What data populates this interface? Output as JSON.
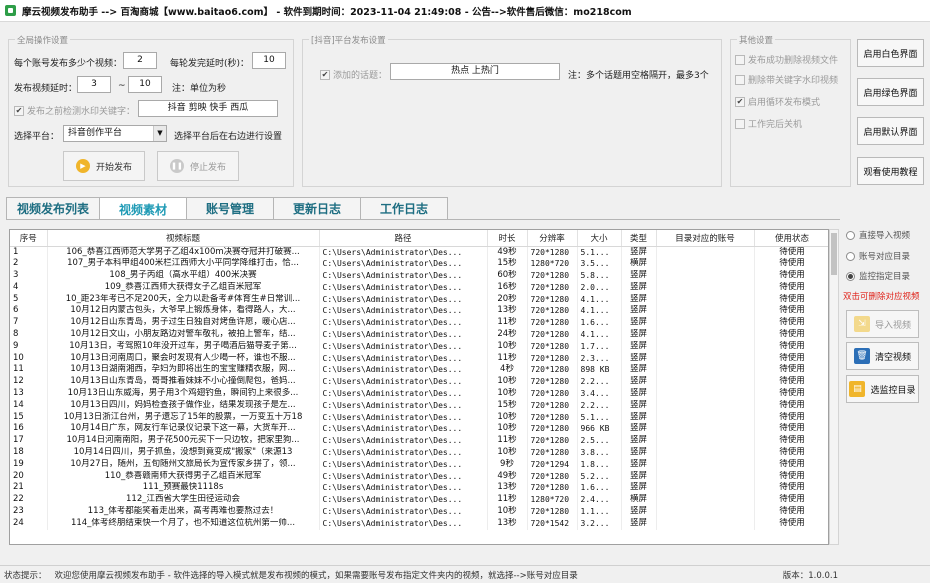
{
  "titlebar": {
    "title": "摩云视频发布助手  --> 百淘商城【www.baitao6.com】 - 软件到期时间：2023-11-04 21:49:08 - 公告-->软件售后微信：mo218com"
  },
  "global_ops": {
    "legend": "全局操作设置",
    "per_account_label": "每个账号发布多少个视频：",
    "per_account_value": "2",
    "global_delay_label": "每轮发完延时(秒)：",
    "global_delay_value": "10",
    "video_delay_label": "发布视频延时：",
    "video_delay_min": "3",
    "tilde": "~",
    "video_delay_max": "10",
    "video_delay_note": "注：单位为秒",
    "detect_watermark_label": "发布之前检测水印关键字：",
    "detect_watermark_value": "抖音 剪映 快手 西瓜",
    "platform_label": "选择平台：",
    "platform_value": "抖音创作平台",
    "platform_note": "选择平台后在右边进行设置",
    "start_label": "开始发布",
    "stop_label": "停止发布"
  },
  "douyin": {
    "legend": "[抖音]平台发布设置",
    "topic_label": "添加的话题：",
    "topic_value": "热点 上热门",
    "topic_note": "注：多个话题用空格隔开，最多3个"
  },
  "other": {
    "legend": "其他设置",
    "opt1": "发布成功删除视频文件",
    "opt2": "删除带关键字水印视频",
    "opt3": "启用循环发布模式",
    "opt4": "工作完后关机"
  },
  "right_buttons": {
    "white": "启用白色界面",
    "green": "启用绿色界面",
    "default": "启用默认界面",
    "tutorial": "观看使用教程"
  },
  "tabs": [
    "视频发布列表",
    "视频素材",
    "账号管理",
    "更新日志",
    "工作日志"
  ],
  "table": {
    "headers": [
      "序号",
      "视频标题",
      "路径",
      "时长",
      "分辨率",
      "大小",
      "类型",
      "目录对应的账号",
      "使用状态"
    ],
    "rows": [
      [
        "1",
        "106_恭喜江西师范大学男子乙组4x100m决赛夺冠并打破赛...",
        "C:\\Users\\Administrator\\Des...",
        "49秒",
        "720*1280",
        "5.1...",
        "竖屏",
        "",
        "待使用"
      ],
      [
        "2",
        "107_男子本科甲组400米栏江西师大小平同学降维打击，恰...",
        "C:\\Users\\Administrator\\Des...",
        "15秒",
        "1280*720",
        "3.5...",
        "横屏",
        "",
        "待使用"
      ],
      [
        "3",
        "108_男子丙组（高水平组）400米决赛",
        "C:\\Users\\Administrator\\Des...",
        "60秒",
        "720*1280",
        "5.8...",
        "竖屏",
        "",
        "待使用"
      ],
      [
        "4",
        "109_恭喜江西师大获得女子乙组百米冠军",
        "C:\\Users\\Administrator\\Des...",
        "16秒",
        "720*1280",
        "2.0...",
        "竖屏",
        "",
        "待使用"
      ],
      [
        "5",
        "10_距23年考已不足200天，全力以赴备考#体育生#日常训...",
        "C:\\Users\\Administrator\\Des...",
        "20秒",
        "720*1280",
        "4.1...",
        "竖屏",
        "",
        "待使用"
      ],
      [
        "6",
        "10月12日内蒙古包头，大爷早上锻炼身体，看得路人，大...",
        "C:\\Users\\Administrator\\Des...",
        "13秒",
        "720*1280",
        "4.1...",
        "竖屏",
        "",
        "待使用"
      ],
      [
        "7",
        "10月12日山东青岛，男子过生日独自对烤鱼许愿，暖心店...",
        "C:\\Users\\Administrator\\Des...",
        "11秒",
        "720*1280",
        "1.6...",
        "竖屏",
        "",
        "待使用"
      ],
      [
        "8",
        "10月12日文山，小朋友路边对警车敬礼，被拍上警车，结...",
        "C:\\Users\\Administrator\\Des...",
        "24秒",
        "720*1280",
        "4.1...",
        "竖屏",
        "",
        "待使用"
      ],
      [
        "9",
        "10月13日，考驾照10年没开过车，男子喝酒后猫导麦子第...",
        "C:\\Users\\Administrator\\Des...",
        "10秒",
        "720*1280",
        "1.7...",
        "竖屏",
        "",
        "待使用"
      ],
      [
        "10",
        "10月13日河南周口，聚会时发现有人少喝一杯，谁也不服...",
        "C:\\Users\\Administrator\\Des...",
        "11秒",
        "720*1280",
        "2.3...",
        "竖屏",
        "",
        "待使用"
      ],
      [
        "11",
        "10月13日湖南湘西，孕妇为即将出生的宝宝赚精衣服，网...",
        "C:\\Users\\Administrator\\Des...",
        "4秒",
        "720*1280",
        "898 KB",
        "竖屏",
        "",
        "待使用"
      ],
      [
        "12",
        "10月13日山东青岛，哥哥推着妹妹不小心撞倒爬包，爸妈...",
        "C:\\Users\\Administrator\\Des...",
        "10秒",
        "720*1280",
        "2.2...",
        "竖屏",
        "",
        "待使用"
      ],
      [
        "13",
        "10月13日山东威海，男子用3个鸡翅钓鱼，瞬间钓上来很多...",
        "C:\\Users\\Administrator\\Des...",
        "10秒",
        "720*1280",
        "3.4...",
        "竖屏",
        "",
        "待使用"
      ],
      [
        "14",
        "10月13日四川，妈妈检查孩子做作业，结果发现孩子是左...",
        "C:\\Users\\Administrator\\Des...",
        "15秒",
        "720*1280",
        "2.2...",
        "竖屏",
        "",
        "待使用"
      ],
      [
        "15",
        "10月13日浙江台州，男子遗忘了15年的股票，一万变五十万18",
        "C:\\Users\\Administrator\\Des...",
        "10秒",
        "720*1280",
        "5.1...",
        "竖屏",
        "",
        "待使用"
      ],
      [
        "16",
        "10月14日广东，网友行车记录仪记录下这一幕，大货车开...",
        "C:\\Users\\Administrator\\Des...",
        "10秒",
        "720*1280",
        "966 KB",
        "竖屏",
        "",
        "待使用"
      ],
      [
        "17",
        "10月14日河南南阳，男子花500元买下一只边牧，把家里狗...",
        "C:\\Users\\Administrator\\Des...",
        "11秒",
        "720*1280",
        "2.5...",
        "竖屏",
        "",
        "待使用"
      ],
      [
        "18",
        "10月14日四川，男子抓鱼，没想到竟变成\"搬家\"（来源13",
        "C:\\Users\\Administrator\\Des...",
        "10秒",
        "720*1280",
        "3.8...",
        "竖屏",
        "",
        "待使用"
      ],
      [
        "19",
        "10月27日，随州，五旬随州文旅局长为宣传家乡拼了，领...",
        "C:\\Users\\Administrator\\Des...",
        "9秒",
        "720*1294",
        "1.8...",
        "竖屏",
        "",
        "待使用"
      ],
      [
        "20",
        "110_恭喜赣南师大获得男子乙组百米冠军",
        "C:\\Users\\Administrator\\Des...",
        "49秒",
        "720*1280",
        "5.2...",
        "竖屏",
        "",
        "待使用"
      ],
      [
        "21",
        "111_预赛最快1118s",
        "C:\\Users\\Administrator\\Des...",
        "13秒",
        "720*1280",
        "1.6...",
        "竖屏",
        "",
        "待使用"
      ],
      [
        "22",
        "112_江西省大学生田径运动会",
        "C:\\Users\\Administrator\\Des...",
        "11秒",
        "1280*720",
        "2.4...",
        "横屏",
        "",
        "待使用"
      ],
      [
        "23",
        "113_体考都能笑着走出来，高考再难也要熬过去！",
        "C:\\Users\\Administrator\\Des...",
        "10秒",
        "720*1280",
        "1.1...",
        "竖屏",
        "",
        "待使用"
      ],
      [
        "24",
        "114_体考终朋结束快一个月了，也不知道这位杭州第一帅...",
        "C:\\Users\\Administrator\\Des...",
        "13秒",
        "720*1542",
        "3.2...",
        "竖屏",
        "",
        "待使用"
      ]
    ]
  },
  "side": {
    "radio_direct": "直接导入视频",
    "radio_account_dir": "账号对应目录",
    "radio_monitor": "监控指定目录",
    "hint": "双击可删除对应视频",
    "import_btn": "导入视频",
    "clear_btn": "清空视频",
    "choose_dir_btn": "选监控目录"
  },
  "status": {
    "prefix": "状态提示：",
    "message": "欢迎您使用摩云视频发布助手  -  软件选择的导入模式就是发布视频的模式，如果需要账号发布指定文件夹内的视频，就选择-->账号对应目录",
    "version": "版本：1.0.0.1"
  },
  "colors": {
    "tab_text": "#1e6e82",
    "tab_active": "#1e9ab5",
    "hint_red": "#e0241b",
    "start_icon": "#f0b52b",
    "import_icon": "#f0b52b",
    "clear_icon": "#2c6fb7",
    "dir_icon": "#f0b52b"
  }
}
